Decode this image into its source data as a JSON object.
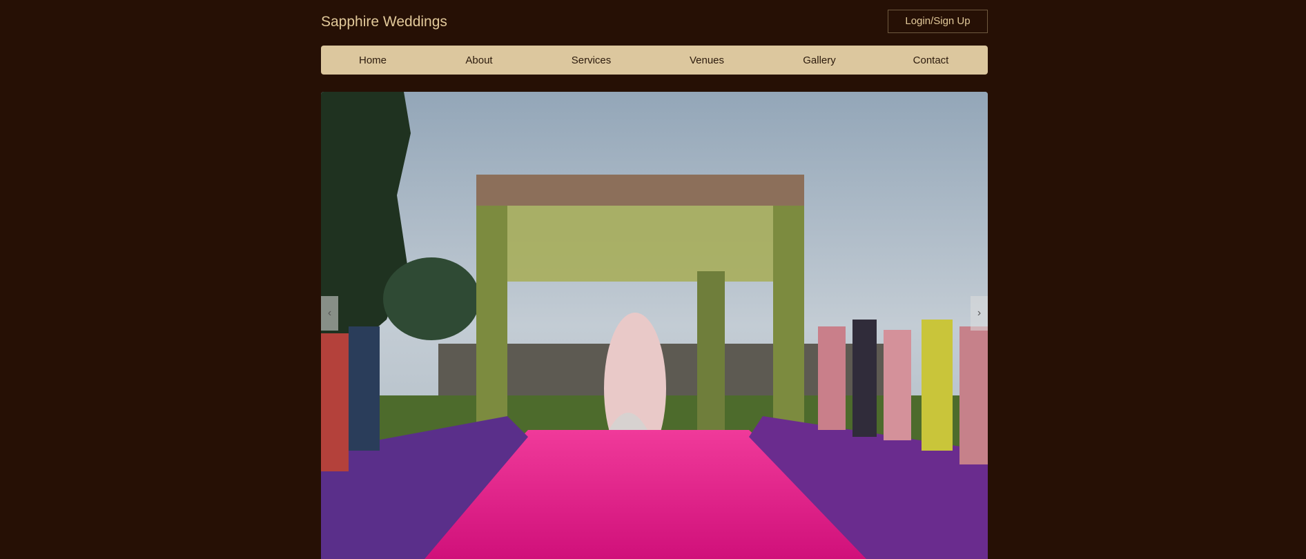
{
  "header": {
    "brand": "Sapphire Weddings",
    "login_label": "Login/Sign Up"
  },
  "nav": {
    "items": [
      {
        "label": "Home"
      },
      {
        "label": "About"
      },
      {
        "label": "Services"
      },
      {
        "label": "Venues"
      },
      {
        "label": "Gallery"
      },
      {
        "label": "Contact"
      }
    ]
  },
  "hero": {
    "prev_icon": "chevron-left-icon",
    "next_icon": "chevron-right-icon"
  },
  "colors": {
    "background": "#261005",
    "brand_text": "#e2c99a",
    "nav_bg": "#dcc79e",
    "nav_text": "#2b1a0c",
    "carpet": "#e0157f"
  }
}
